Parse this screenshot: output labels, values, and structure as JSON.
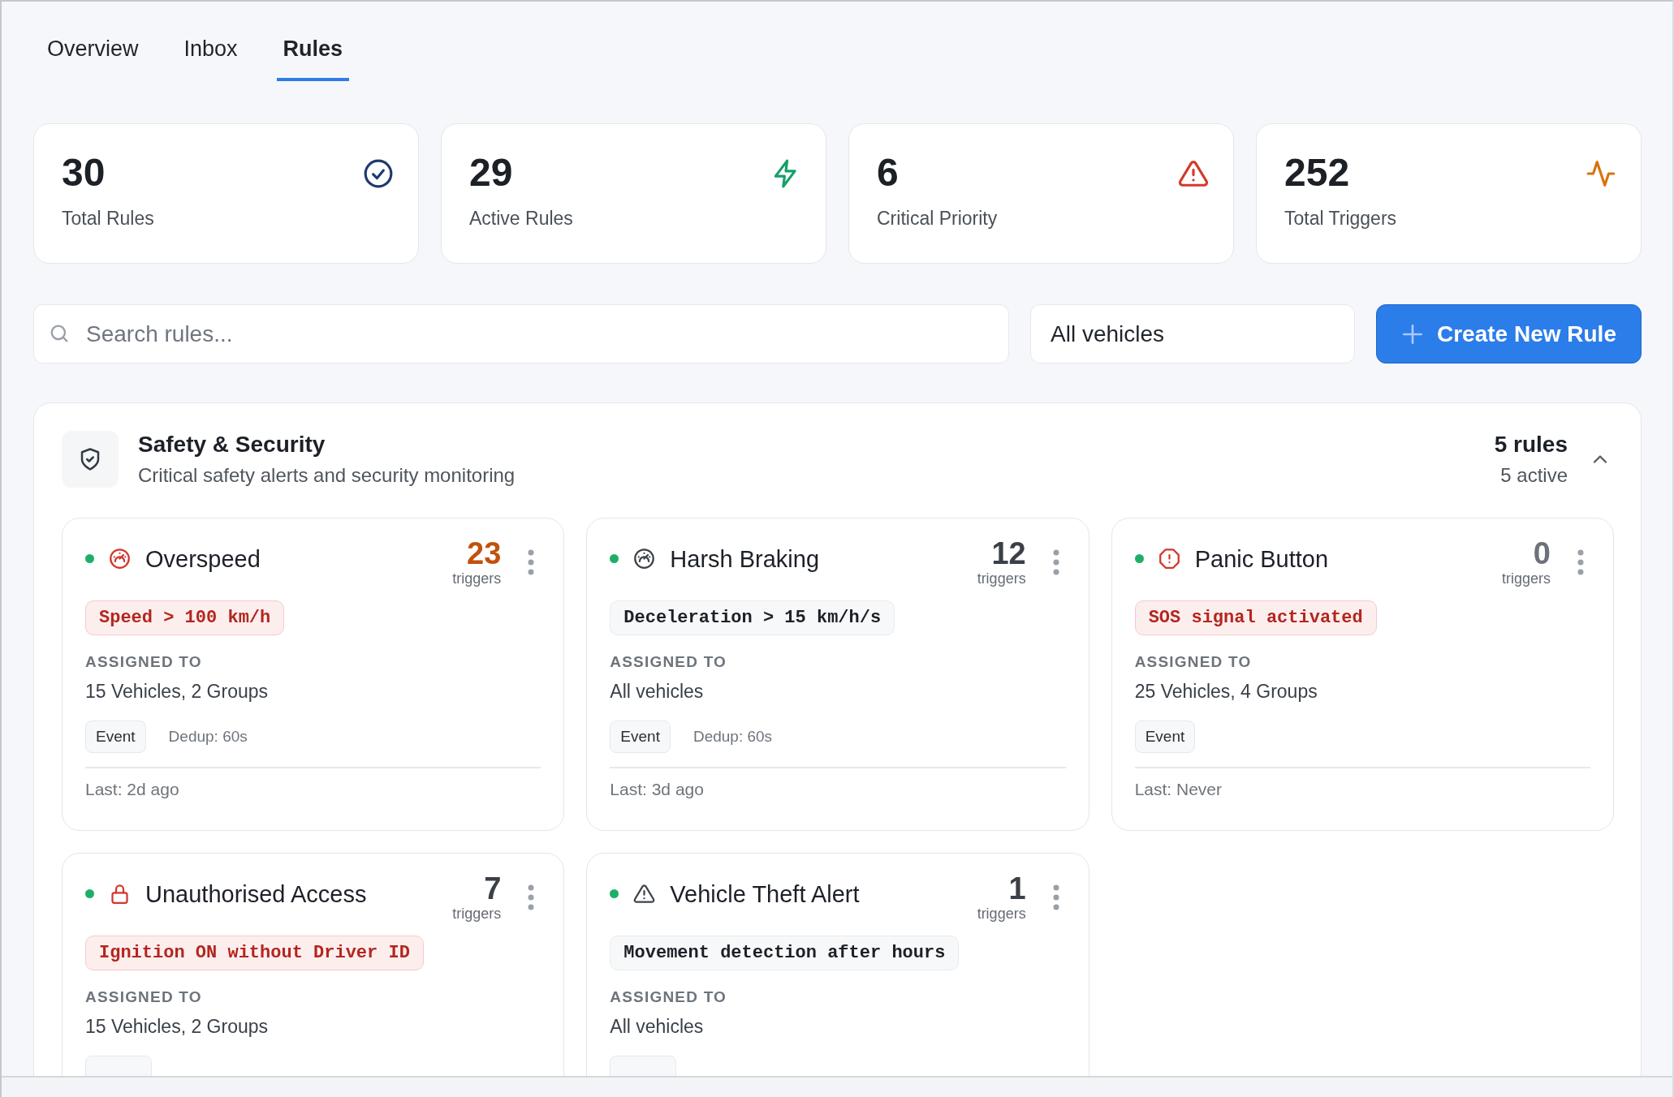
{
  "tabs": [
    {
      "label": "Overview",
      "selected": false
    },
    {
      "label": "Inbox",
      "selected": false
    },
    {
      "label": "Rules",
      "selected": true
    }
  ],
  "stats": [
    {
      "value": "30",
      "label": "Total Rules",
      "kind": "check"
    },
    {
      "value": "29",
      "label": "Active Rules",
      "kind": "bolt"
    },
    {
      "value": "6",
      "label": "Critical Priority",
      "kind": "alert"
    },
    {
      "value": "252",
      "label": "Total Triggers",
      "kind": "pulse"
    }
  ],
  "search": {
    "placeholder": "Search rules..."
  },
  "vehicle_filter": {
    "value": "All vehicles"
  },
  "create_button": {
    "label": "Create New Rule"
  },
  "section": {
    "title": "Safety & Security",
    "subtitle": "Critical safety alerts and security monitoring",
    "rule_count": "5 rules",
    "active_count": "5 active",
    "expanded": true,
    "rules": [
      {
        "name": "Overspeed",
        "active": true,
        "kind": "gauge",
        "critical": true,
        "triggers": "23",
        "color": "#c2510c",
        "triggers_label": "triggers",
        "condition": "Speed > 100 km/h",
        "assigned_label": "ASSIGNED TO",
        "assigned": "15 Vehicles, 2 Groups",
        "tags": [
          {
            "label": "Event",
            "kind": "chip"
          },
          {
            "label": "Dedup: 60s",
            "kind": "plain"
          }
        ],
        "last": "Last: 2d ago"
      },
      {
        "name": "Harsh Braking",
        "active": true,
        "kind": "gauge",
        "critical": false,
        "triggers": "12",
        "color": "#3b4048",
        "triggers_label": "triggers",
        "condition": "Deceleration > 15 km/h/s",
        "assigned_label": "ASSIGNED TO",
        "assigned": "All vehicles",
        "tags": [
          {
            "label": "Event",
            "kind": "chip"
          },
          {
            "label": "Dedup: 60s",
            "kind": "plain"
          }
        ],
        "last": "Last: 3d ago"
      },
      {
        "name": "Panic Button",
        "active": true,
        "kind": "octagon",
        "critical": true,
        "triggers": "0",
        "color": "#6c727a",
        "triggers_label": "triggers",
        "condition": "SOS signal activated",
        "assigned_label": "ASSIGNED TO",
        "assigned": "25 Vehicles, 4 Groups",
        "tags": [
          {
            "label": "Event",
            "kind": "chip"
          }
        ],
        "last": "Last: Never"
      },
      {
        "name": "Unauthorised Access",
        "active": true,
        "kind": "lock",
        "critical": true,
        "triggers": "7",
        "color": "#3b4048",
        "triggers_label": "triggers",
        "condition": "Ignition ON without Driver ID",
        "assigned_label": "ASSIGNED TO",
        "assigned": "15 Vehicles, 2 Groups"
      },
      {
        "name": "Vehicle Theft Alert",
        "active": true,
        "kind": "triangle",
        "critical": false,
        "triggers": "1",
        "color": "#3b4048",
        "triggers_label": "triggers",
        "condition": "Movement detection after hours",
        "assigned_label": "ASSIGNED TO",
        "assigned": "All vehicles"
      }
    ]
  }
}
